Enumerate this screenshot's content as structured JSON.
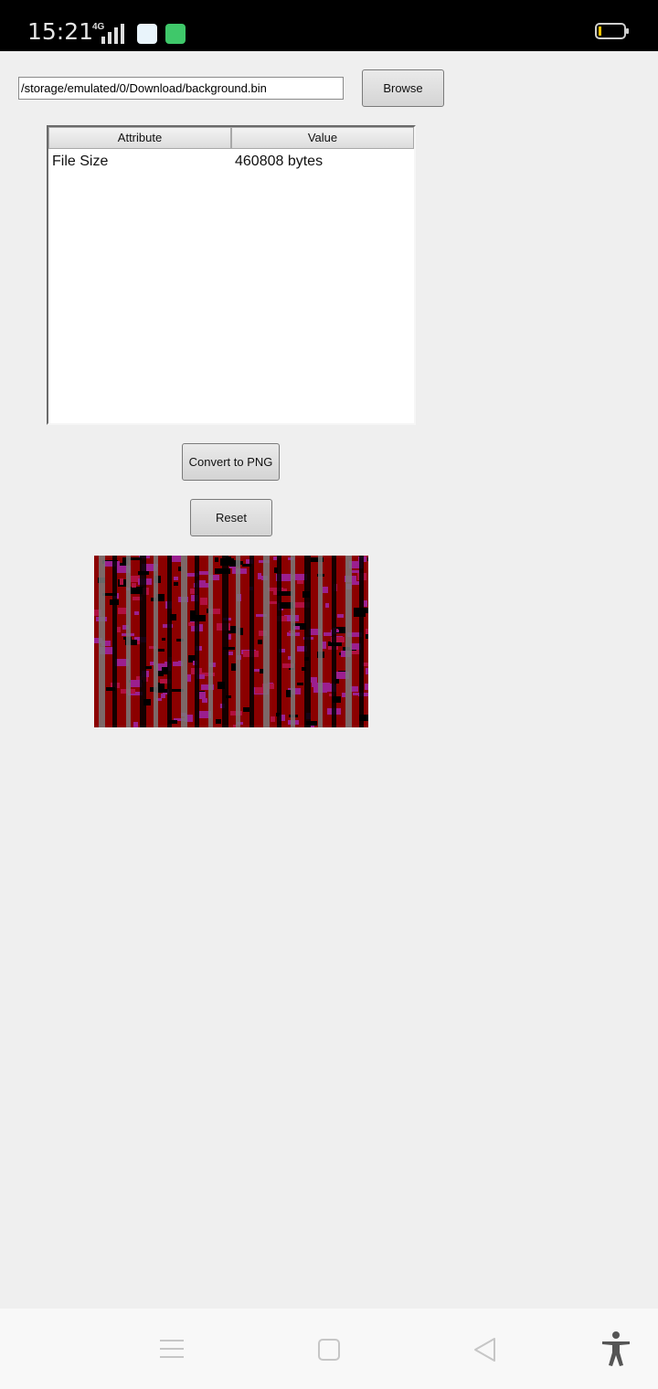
{
  "status_bar": {
    "time": "15:21",
    "network": "4G",
    "battery_level_fraction": 0.1,
    "icons": [
      "signal-icon",
      "app-notification-icon",
      "app-notification-icon",
      "battery-icon"
    ]
  },
  "file": {
    "path_value": "/storage/emulated/0/Download/background.bin",
    "browse_label": "Browse"
  },
  "table": {
    "headers": [
      "Attribute",
      "Value"
    ],
    "rows": [
      {
        "attribute": "File Size",
        "value": "460808 bytes"
      }
    ]
  },
  "actions": {
    "convert_label": "Convert to PNG",
    "reset_label": "Reset"
  },
  "preview": {
    "colors": {
      "dark_red": "#8b0000",
      "magenta": "#9b1f8f",
      "gray": "#7a7a7a",
      "black": "#000000"
    }
  },
  "nav_bar": {
    "icons": [
      "menu-icon",
      "home-icon",
      "back-icon",
      "accessibility-icon"
    ]
  }
}
